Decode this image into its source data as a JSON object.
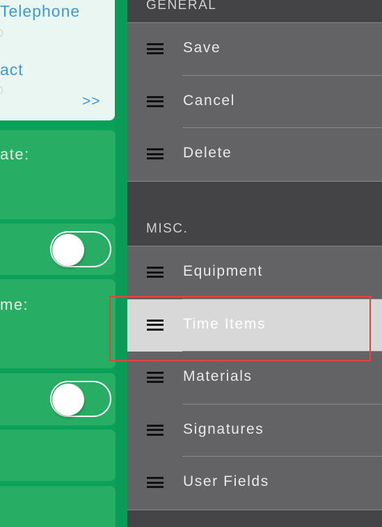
{
  "contact_card": {
    "line1": "Telephone",
    "line2": "act",
    "more_label": ">>"
  },
  "form": {
    "label1": "ate:",
    "label2": "me:"
  },
  "menu": {
    "general_header": "GENERAL",
    "general_items": [
      {
        "label": "Save",
        "icon": "hamburger-icon"
      },
      {
        "label": "Cancel",
        "icon": "hamburger-icon"
      },
      {
        "label": "Delete",
        "icon": "hamburger-icon"
      }
    ],
    "misc_header": "MISC.",
    "misc_items": [
      {
        "label": "Equipment",
        "icon": "hamburger-icon"
      },
      {
        "label": "Time Items",
        "icon": "hamburger-icon",
        "selected": true
      },
      {
        "label": "Materials",
        "icon": "hamburger-icon"
      },
      {
        "label": "Signatures",
        "icon": "hamburger-icon"
      },
      {
        "label": "User Fields",
        "icon": "hamburger-icon"
      }
    ]
  },
  "colors": {
    "green_panel": "#0ba05a",
    "green_block": "#27ae64",
    "link_blue": "#3b9bd6",
    "menu_bg": "#444447",
    "menu_group": "#636366",
    "selected_row": "#d8d8d8",
    "highlight": "#e0453e"
  }
}
